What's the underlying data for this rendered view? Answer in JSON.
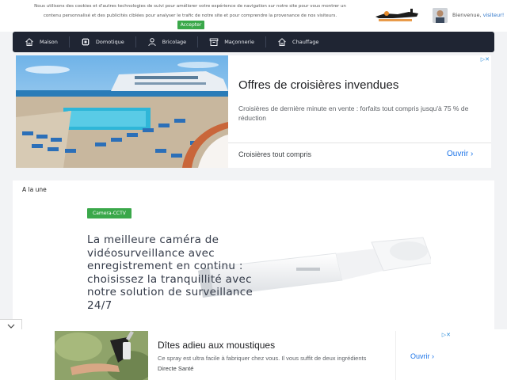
{
  "cookie_banner": {
    "line1": "Nous utilisons des cookies et d'autres technologies de suivi pour améliorer votre expérience de navigation sur notre site pour vous montrer un",
    "line2": "contenu personnalisé et des publicités ciblées pour analyser le trafic de notre site et pour comprendre la provenance de nos visiteurs.",
    "accept_label": "Accepter"
  },
  "header": {
    "logo_icon": "bricolage-logo",
    "welcome": "Bienvenue,",
    "user": "visiteur!"
  },
  "nav": {
    "items": [
      {
        "label": "Maison",
        "icon": "house-icon"
      },
      {
        "label": "Domotique",
        "icon": "chip-icon"
      },
      {
        "label": "Bricolage",
        "icon": "person-icon"
      },
      {
        "label": "Maçonnerie",
        "icon": "box-icon"
      },
      {
        "label": "Chauffage",
        "icon": "house-icon"
      }
    ]
  },
  "ad_top": {
    "title": "Offres de croisières invendues",
    "description": "Croisières de dernière minute en vente : forfaits tout compris jusqu'à 75 % de réduction",
    "brand": "Croisières tout compris",
    "open_label": "Ouvrir",
    "close_glyph": "▷✕"
  },
  "main": {
    "section_title": "A la une",
    "tag": "Camera-CCTV",
    "headline": "La meilleure caméra de vidéosurveillance avec enregistrement en continu : choisissez la tranquillité avec notre solution de surveillance 24/7"
  },
  "ad_bottom": {
    "title": "Dîtes adieu aux moustiques",
    "description": "Ce spray est ultra facile à fabriquer chez vous. Il vous suffit de deux ingrédients",
    "brand": "Directe Santé",
    "open_label": "Ouvrir",
    "close_glyph": "▷✕"
  },
  "colors": {
    "nav_bg": "#1f2533",
    "accent_green": "#3aa84a",
    "link_blue": "#1a73e8"
  }
}
